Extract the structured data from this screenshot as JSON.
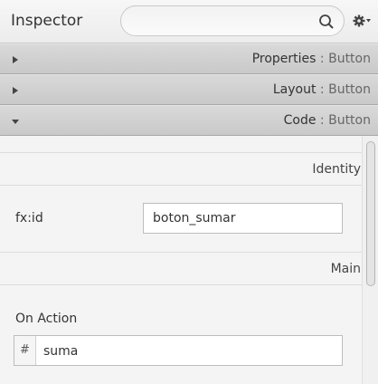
{
  "header": {
    "title": "Inspector",
    "search_placeholder": "",
    "search_icon": "search-icon",
    "settings_icon": "gear-icon"
  },
  "sections": [
    {
      "name": "Properties",
      "sub": "Button",
      "expanded": false
    },
    {
      "name": "Layout",
      "sub": "Button",
      "expanded": false
    },
    {
      "name": "Code",
      "sub": "Button",
      "expanded": true
    }
  ],
  "separator": " : ",
  "code": {
    "identity_header": "Identity",
    "fxid_label": "fx:id",
    "fxid_value": "boton_sumar",
    "main_header": "Main",
    "on_action_label": "On Action",
    "on_action_prefix": "#",
    "on_action_value": "suma"
  }
}
